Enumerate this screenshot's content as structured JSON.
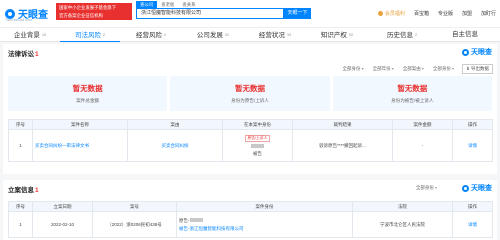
{
  "header": {
    "logo_text": "天眼查",
    "logo_sub": "TianYanCha.com",
    "promo_line1": "国家中小企业发展子基金旗下",
    "promo_line2": "官方备案企业征信机构",
    "search_tabs": [
      "查公司",
      "查老板",
      "查关系"
    ],
    "search_value": "浙江恒魔智能科技有限公司",
    "search_button": "天眼一下",
    "links": [
      "会员福利",
      "百宝箱",
      "专业版",
      "加盟",
      "加盯行"
    ],
    "vip_color": "#e9a23b"
  },
  "nav": [
    {
      "label": "企业背景",
      "count": "16"
    },
    {
      "label": "司法风险",
      "count": "2"
    },
    {
      "label": "经营风险",
      "count": "0"
    },
    {
      "label": "公司发展",
      "count": "52"
    },
    {
      "label": "经营状况",
      "count": "33"
    },
    {
      "label": "知识产权",
      "count": "50"
    },
    {
      "label": "历史信息",
      "count": "2"
    },
    {
      "label": "自主信息",
      "count": ""
    }
  ],
  "lawsuit": {
    "title": "法律诉讼",
    "count": "1",
    "brand": "天眼查",
    "filters": [
      "全部身份",
      "全部年份",
      "全部案由",
      "全部身份"
    ],
    "export": "导出数据",
    "summary": [
      {
        "value": "暂无数据",
        "label": "案件总金额"
      },
      {
        "value": "暂无数据",
        "label": "身份为原告/上诉人"
      },
      {
        "value": "暂无数据",
        "label": "身份为被告/被上诉人"
      }
    ],
    "columns": [
      "序号",
      "案件名称",
      "案由",
      "在本案中身份",
      "裁判结果",
      "案件金额",
      "操作"
    ],
    "rows": [
      {
        "no": "1",
        "name": "买卖合同纠纷一审法律文书",
        "cause": "买卖合同纠纷",
        "role_tag": "原告/上诉人",
        "role": "被告",
        "result": "驳诉原告****撤回起诉...",
        "amount": "-",
        "action": "详情"
      }
    ]
  },
  "filing": {
    "title": "立案信息",
    "count": "1",
    "brand": "天眼查",
    "filters": [
      "全部身份"
    ],
    "columns": [
      "序号",
      "立案日期",
      "案号",
      "案件身份",
      "法院",
      "操作"
    ],
    "rows": [
      {
        "no": "1",
        "date": "2022-02-10",
        "case_no": "（2022）浙0206民初438号",
        "plaintiff_prefix": "原告-",
        "defendant": "被告-浙江恒魔智能科技有限公司",
        "court": "宁波市北仑区人民法院",
        "action": "详情"
      }
    ]
  },
  "colors": {
    "primary": "#0084ff",
    "danger": "#e8312f"
  }
}
